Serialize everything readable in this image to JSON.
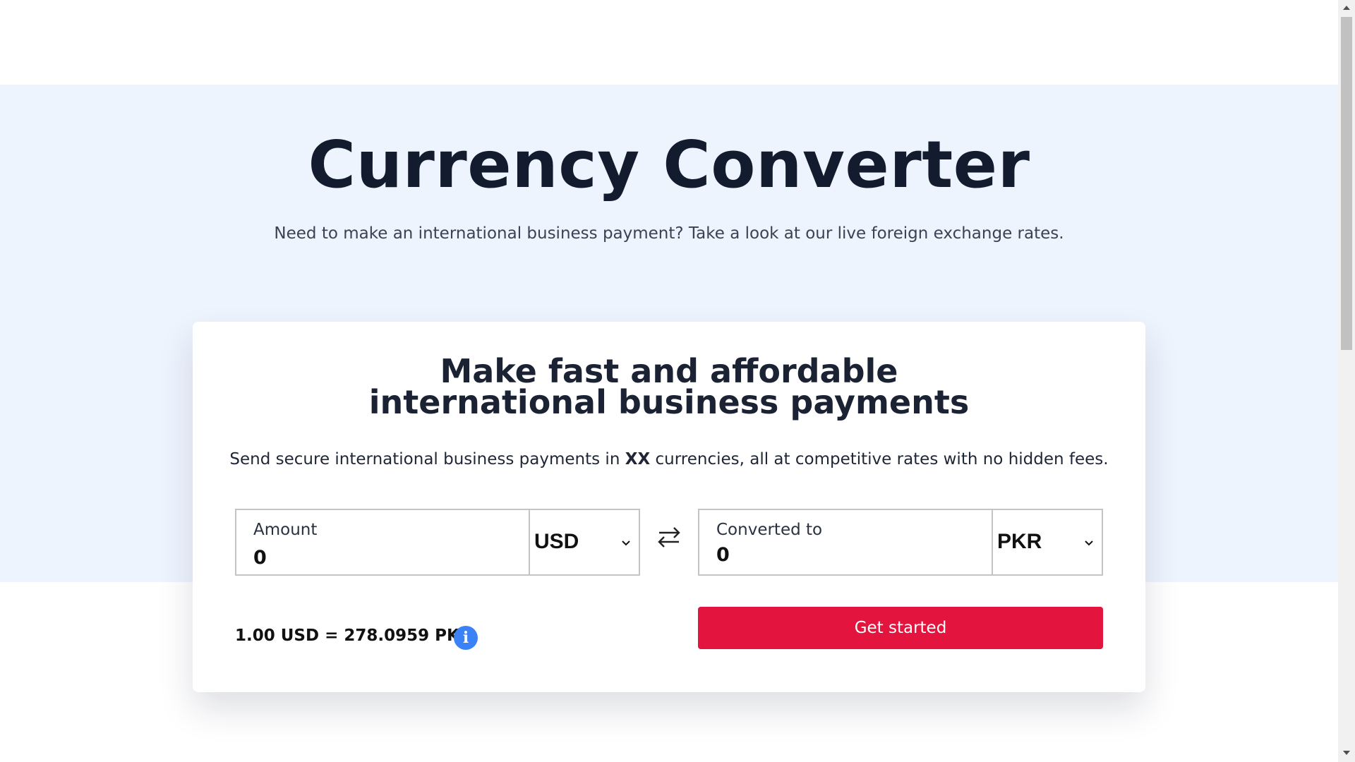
{
  "hero": {
    "title": "Currency Converter",
    "subtitle": "Need to make an international business payment? Take a look at our live foreign exchange rates."
  },
  "card": {
    "heading_line1": "Make fast and affordable",
    "heading_line2": "international business payments",
    "desc_before": "Send secure international business payments in ",
    "desc_bold": "XX",
    "desc_after": " currencies, all at competitive rates with no hidden fees."
  },
  "converter": {
    "from": {
      "label": "Amount",
      "value": "0",
      "currency": "USD"
    },
    "to": {
      "label": "Converted to",
      "value": "0",
      "currency": "PKR"
    },
    "swap_icon": "swap-arrows-icon",
    "rate_text": "1.00 USD = 278.0959 PKR",
    "info_icon": "info-icon",
    "info_glyph": "i",
    "cta_label": "Get started"
  },
  "colors": {
    "hero_bg": "#eef4fe",
    "cta": "#e3143d",
    "info": "#3b82f6",
    "text": "#1a2233"
  }
}
